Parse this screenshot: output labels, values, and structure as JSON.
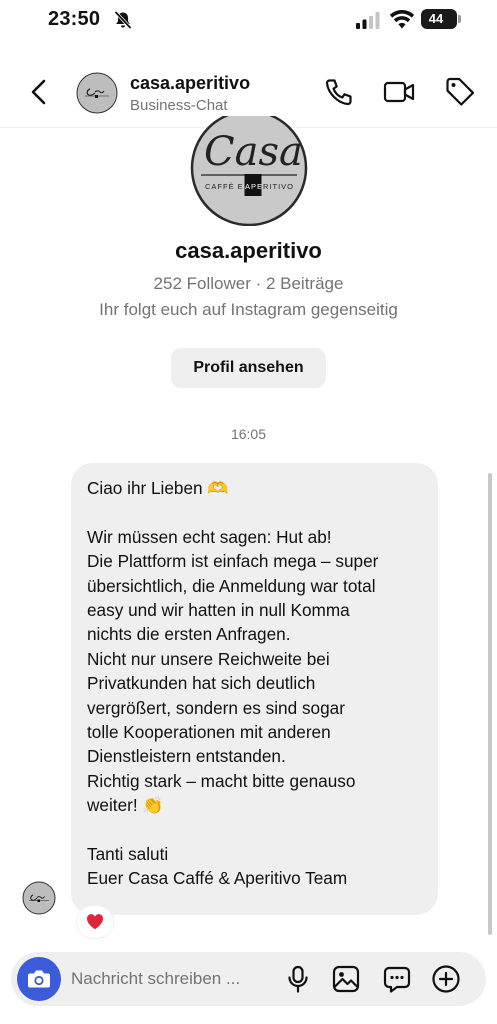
{
  "status_bar": {
    "time": "23:50",
    "battery": "44"
  },
  "header": {
    "title": "casa.aperitivo",
    "subtitle": "Business-Chat",
    "icons": [
      "back-icon",
      "phone-icon",
      "video-camera-icon",
      "tag-icon"
    ]
  },
  "brand_logo": {
    "script_text": "Casa",
    "tagline_left": "CAFFÈ E ",
    "tagline_highlight": "APE",
    "tagline_right": "RITIVO"
  },
  "profile": {
    "name": "casa.aperitivo",
    "stats": "252 Follower · 2 Beiträge",
    "mutual": "Ihr folgt euch auf Instagram gegenseitig",
    "view_button": "Profil ansehen"
  },
  "thread": {
    "timestamp": "16:05",
    "message": {
      "lines": [
        "Ciao ihr Lieben 🫶",
        "",
        "Wir müssen echt sagen: Hut ab!",
        "Die Plattform ist einfach mega – super",
        "übersichtlich, die Anmeldung war total",
        "easy und wir hatten in null Komma",
        "nichts die ersten Anfragen.",
        "Nicht nur unsere Reichweite bei",
        "Privatkunden hat sich deutlich",
        "vergrößert, sondern es sind sogar",
        "tolle Kooperationen mit anderen",
        "Dienstleistern entstanden.",
        "Richtig stark – macht bitte genauso",
        "weiter! 👏",
        "",
        "Tanti saluti",
        "Euer Casa Caffé & Aperitivo Team"
      ],
      "reaction": "❤️"
    }
  },
  "composer": {
    "placeholder": "Nachricht schreiben ...",
    "icons": [
      "camera-icon",
      "microphone-icon",
      "gallery-icon",
      "sticker-icon",
      "plus-icon"
    ]
  },
  "colors": {
    "accent_blue": "#3b5bdb",
    "bubble_bg": "#efefef",
    "secondary_text": "#737373",
    "heart_red": "#e0243a"
  }
}
